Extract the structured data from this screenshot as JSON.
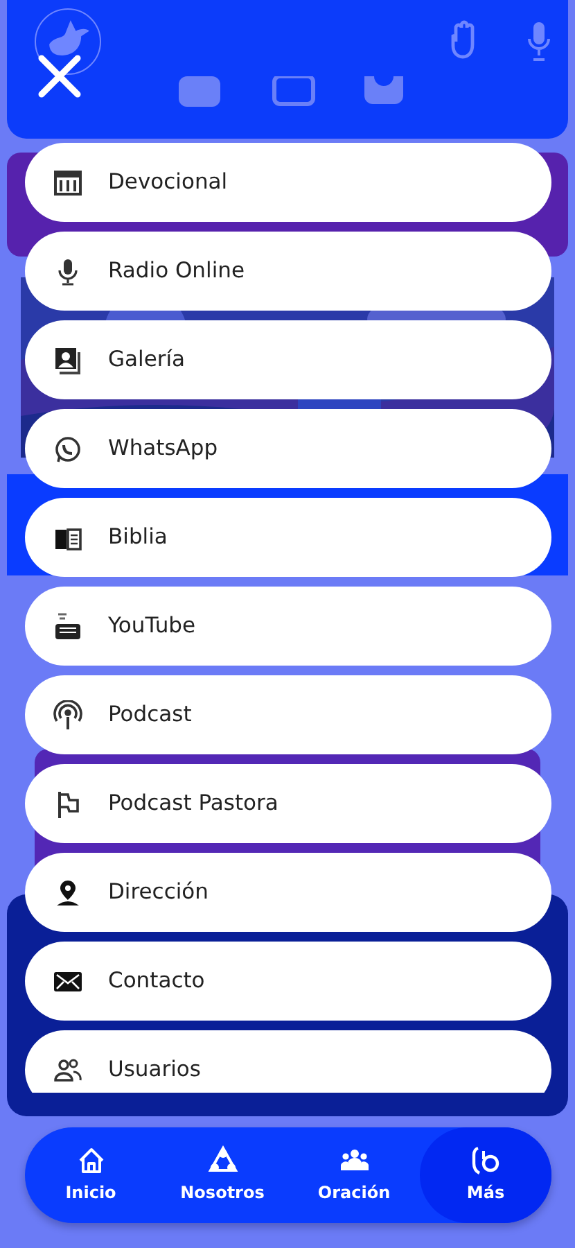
{
  "menu": {
    "items": [
      {
        "label": "Devocional"
      },
      {
        "label": "Radio Online"
      },
      {
        "label": "Galería"
      },
      {
        "label": "WhatsApp"
      },
      {
        "label": "Biblia"
      },
      {
        "label": "YouTube"
      },
      {
        "label": "Podcast"
      },
      {
        "label": "Podcast Pastora"
      },
      {
        "label": "Dirección"
      },
      {
        "label": "Contacto"
      },
      {
        "label": "Usuarios"
      }
    ]
  },
  "bottom_nav": [
    {
      "label": "Inicio",
      "selected": false
    },
    {
      "label": "Nosotros",
      "selected": false
    },
    {
      "label": "Oración",
      "selected": false
    },
    {
      "label": "Más",
      "selected": true
    }
  ]
}
